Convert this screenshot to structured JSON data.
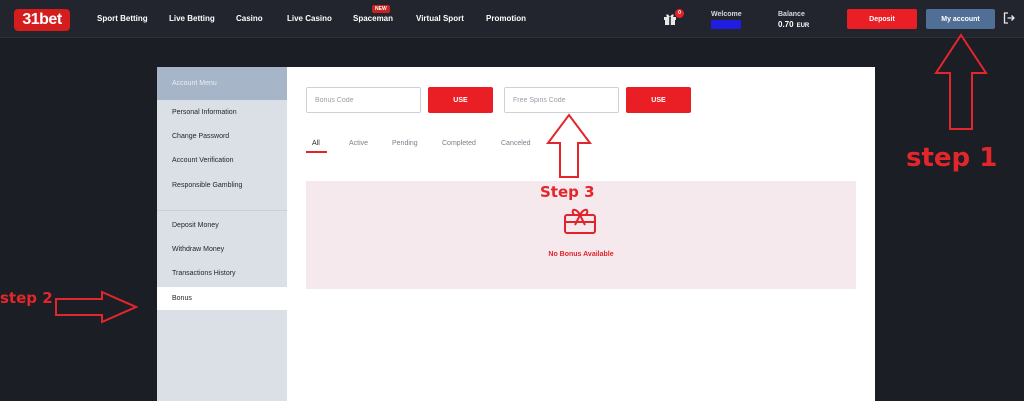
{
  "header": {
    "logo": "31bet",
    "nav": [
      {
        "label": "Sport Betting"
      },
      {
        "label": "Live Betting"
      },
      {
        "label": "Casino"
      },
      {
        "label": "Live Casino"
      },
      {
        "label": "Spaceman",
        "badge": "NEW"
      },
      {
        "label": "Virtual Sport"
      },
      {
        "label": "Promotion"
      }
    ],
    "gift_count": "0",
    "welcome_label": "Welcome",
    "balance_label": "Balance",
    "balance_value": "0.70",
    "balance_currency": "EUR",
    "deposit_label": "Deposit",
    "my_account_label": "My account",
    "icons": {
      "gift": "gift-icon",
      "logout": "logout-icon"
    }
  },
  "sidebar": {
    "title": "Account Menu",
    "items": [
      {
        "label": "Personal Information"
      },
      {
        "label": "Change Password"
      },
      {
        "label": "Account Verification"
      },
      {
        "label": "Responsible Gambling"
      },
      {
        "label": "Deposit Money"
      },
      {
        "label": "Withdraw Money"
      },
      {
        "label": "Transactions History"
      },
      {
        "label": "Bonus",
        "active": true
      }
    ]
  },
  "bonus": {
    "bonus_code_placeholder": "Bonus Code",
    "free_spins_placeholder": "Free Spins Code",
    "use_label": "USE",
    "tabs": [
      {
        "label": "All",
        "active": true
      },
      {
        "label": "Active"
      },
      {
        "label": "Pending"
      },
      {
        "label": "Completed"
      },
      {
        "label": "Canceled"
      }
    ],
    "empty_text": "No Bonus Available",
    "empty_icon": "gift-card-icon"
  },
  "annotations": {
    "step1": "step 1",
    "step2": "step 2",
    "step3": "Step 3"
  },
  "colors": {
    "brand_red": "#ea1f25",
    "account_blue": "#4f6f96",
    "annotation_red": "#e3262b"
  }
}
